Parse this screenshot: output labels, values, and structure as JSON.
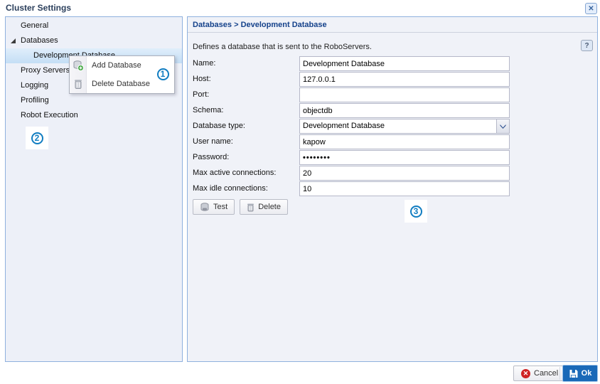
{
  "window": {
    "title": "Cluster Settings"
  },
  "icons": {
    "close": "✕",
    "help": "?",
    "cancel_x": "✕"
  },
  "sidebar": {
    "items": [
      {
        "label": "General"
      },
      {
        "label": "Databases",
        "expanded": true
      },
      {
        "label": "Development Database",
        "selected": true
      },
      {
        "label": "Proxy Servers"
      },
      {
        "label": "Logging"
      },
      {
        "label": "Profiling"
      },
      {
        "label": "Robot Execution"
      }
    ]
  },
  "context_menu": {
    "items": [
      {
        "label": "Add Database",
        "icon": "database-add-icon"
      },
      {
        "label": "Delete Database",
        "icon": "trash-icon"
      }
    ]
  },
  "annotations": {
    "one": "1",
    "two": "2",
    "three": "3"
  },
  "main": {
    "breadcrumb": "Databases > Development Database",
    "description": "Defines a database that is sent to the RoboServers.",
    "fields": [
      {
        "label": "Name:",
        "value": "Development Database",
        "type": "text"
      },
      {
        "label": "Host:",
        "value": "127.0.0.1",
        "type": "text"
      },
      {
        "label": "Port:",
        "value": "",
        "type": "text"
      },
      {
        "label": "Schema:",
        "value": "objectdb",
        "type": "text"
      },
      {
        "label": "Database type:",
        "value": "Development Database",
        "type": "select"
      },
      {
        "label": "User name:",
        "value": "kapow",
        "type": "text"
      },
      {
        "label": "Password:",
        "value": "••••••••",
        "type": "password"
      },
      {
        "label": "Max active connections:",
        "value": "20",
        "type": "text"
      },
      {
        "label": "Max idle connections:",
        "value": "10",
        "type": "text"
      }
    ],
    "buttons": {
      "test": "Test",
      "delete": "Delete"
    }
  },
  "footer": {
    "cancel": "Cancel",
    "ok": "Ok"
  },
  "colors": {
    "panel_border": "#8fb1de",
    "panel_background": "#f0f2f8",
    "header_text": "#15428b",
    "selection_background": "#c4def5",
    "annotation_blue": "#117dc1",
    "ok_button_blue": "#1a69b8",
    "cancel_icon_red": "#cf2323"
  }
}
